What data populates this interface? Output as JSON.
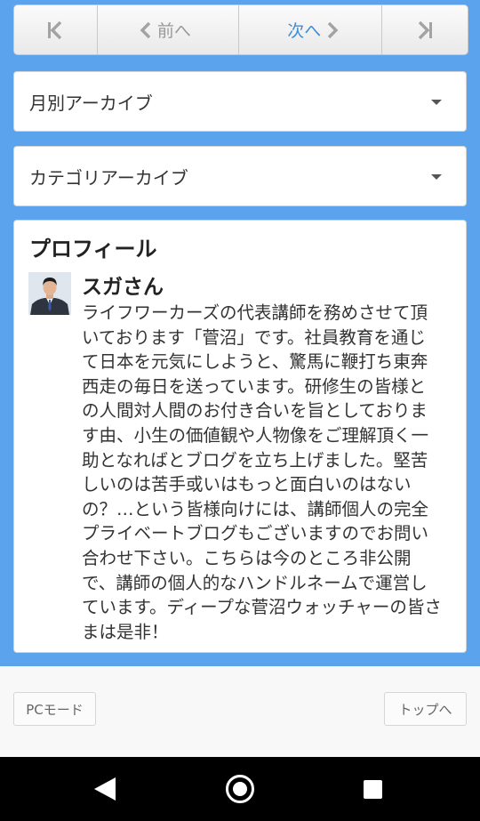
{
  "pager": {
    "first_icon": "skip-first-icon",
    "prev_label": "前へ",
    "prev_icon": "chevron-left-icon",
    "next_label": "次へ",
    "next_icon": "chevron-right-icon",
    "last_icon": "skip-last-icon"
  },
  "archives": {
    "monthly_label": "月別アーカイブ",
    "category_label": "カテゴリアーカイブ"
  },
  "profile": {
    "title": "プロフィール",
    "name": "スガさん",
    "description": "ライフワーカーズの代表講師を務めさせて頂いております「菅沼」です。社員教育を通じて日本を元気にしようと、驚馬に鞭打ち東奔西走の毎日を送っています。研修生の皆様との人間対人間のお付き合いを旨としております由、小生の価値観や人物像をご理解頂く一助となればとブログを立ち上げました。堅苦しいのは苦手或いはもっと面白いのはないの？…という皆様向けには、講師個人の完全プライベートブログもございますのでお問い合わせ下さい。こちらは今のところ非公開で、講師の個人的なハンドルネームで運営しています。ディープな菅沼ウォッチャーの皆さまは是非！"
  },
  "footer": {
    "pc_mode_label": "PCモード",
    "top_label": "トップへ"
  },
  "colors": {
    "background_blue": "#5ba4ed",
    "next_accent": "#3d8ed6"
  }
}
